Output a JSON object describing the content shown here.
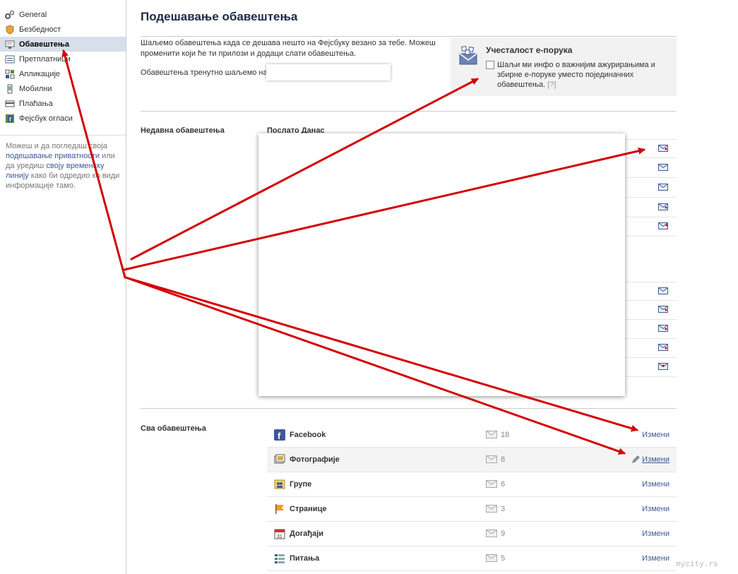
{
  "sidebar": {
    "items": [
      {
        "label": "General",
        "icon": "gears-icon"
      },
      {
        "label": "Безбедност",
        "icon": "shield-icon"
      },
      {
        "label": "Обавештења",
        "icon": "notification-icon"
      },
      {
        "label": "Претплатници",
        "icon": "subscribers-icon"
      },
      {
        "label": "Апликације",
        "icon": "apps-icon"
      },
      {
        "label": "Мобилни",
        "icon": "mobile-icon"
      },
      {
        "label": "Плаћања",
        "icon": "payments-icon"
      },
      {
        "label": "Фејсбук огласи",
        "icon": "facebook-ads-icon"
      }
    ],
    "active_index": 2,
    "note": {
      "text1": "Можеш и да погледаш своја ",
      "link1": "подешавање приватности",
      "text2": " или да уредиш ",
      "link2": "своју временску линију",
      "text3": " како би одредио ко види информације тамо."
    }
  },
  "main": {
    "title": "Подешавање обавештења",
    "intro": "Шаљемо обавештења када се дешава нешто на Фејсбуку везано за тебе. Можеш променити који ће ти прилози и додаци слати обавештења.",
    "sent_to_label": "Обавештења тренутно шаљемо на",
    "email_frequency": {
      "title": "Учесталост е-порука",
      "checkbox_label": "Шаљи ми инфо о важнијим ажурирањима и збирне е-поруке уместо појединачних обавештења.",
      "help": "[?]",
      "checked": false
    },
    "recent": {
      "label": "Недавна обавештења",
      "column_head": "Послато Данас"
    },
    "all": {
      "label": "Сва обавештења",
      "apps": [
        {
          "name": "Facebook",
          "count": "18",
          "edit": "Измени",
          "icon": "facebook-icon"
        },
        {
          "name": "Фотографије",
          "count": "8",
          "edit": "Измени",
          "icon": "photos-icon"
        },
        {
          "name": "Групе",
          "count": "6",
          "edit": "Измени",
          "icon": "groups-icon"
        },
        {
          "name": "Странице",
          "count": "3",
          "edit": "Измени",
          "icon": "pages-icon"
        },
        {
          "name": "Догађаји",
          "count": "9",
          "edit": "Измени",
          "icon": "events-icon"
        },
        {
          "name": "Питања",
          "count": "5",
          "edit": "Измени",
          "icon": "questions-icon"
        }
      ]
    }
  },
  "watermark": "mycity.rs",
  "colors": {
    "link": "#3b5998",
    "active_bg": "#d8dfea",
    "annotation_arrow": "#d40000"
  }
}
